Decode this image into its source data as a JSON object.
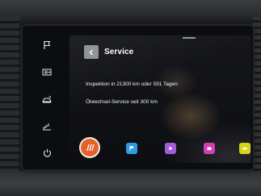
{
  "screen": {
    "title": "Service",
    "lines": [
      "Inspektion in 21300 km oder 591 Tagen",
      "Ölwechsel-Service seit 300 km"
    ]
  },
  "side_buttons": [
    {
      "icon": "flag-icon"
    },
    {
      "icon": "radio-icon"
    },
    {
      "icon": "vehicle-settings-icon"
    },
    {
      "icon": "phone-icon"
    },
    {
      "icon": "power-icon"
    }
  ],
  "dock": {
    "home": {
      "icon": "home-stripes-icon",
      "color": "#e4622a"
    },
    "apps": [
      {
        "name": "navigation-app-icon",
        "color": "#2d9be6"
      },
      {
        "name": "media-app-icon",
        "color": "#a25bd9"
      },
      {
        "name": "phone-app-icon",
        "color": "#d23fb3"
      },
      {
        "name": "settings-app-icon",
        "color": "#d8d21c"
      }
    ]
  },
  "colors": {
    "screen_bg": "#0d0e12",
    "back_button": "#8f9096",
    "text": "#ffffff"
  }
}
